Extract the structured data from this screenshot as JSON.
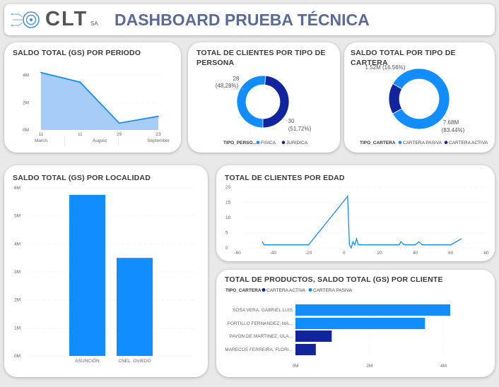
{
  "header": {
    "logo_text": "CLT",
    "logo_suffix": "SA",
    "title": "DASHBOARD PRUEBA TÉCNICA",
    "accent": "#5a6b9a"
  },
  "colors": {
    "primary": "#118dff",
    "dark": "#12239e",
    "area_fill": "#a7cdf6"
  },
  "chart_data": [
    {
      "id": "saldo_periodo",
      "type": "area",
      "title": "SALDO TOTAL (GS) POR PERIODO",
      "x_ticks": [
        "11",
        "11",
        "29",
        "23"
      ],
      "x_groups": [
        "March",
        "August",
        "September"
      ],
      "y_ticks": [
        "4M",
        "2M",
        "0M"
      ],
      "values": [
        4.2,
        3.5,
        0.5,
        1.0
      ],
      "ylim": [
        0,
        4.5
      ]
    },
    {
      "id": "clientes_persona",
      "type": "pie",
      "title": "TOTAL DE CLIENTES POR TIPO DE PERSONA",
      "legend_title": "TIPO_PERSO...",
      "slices": [
        {
          "name": "FISICA",
          "value": 30,
          "label": "30",
          "pct": "(51.72%)",
          "color": "#118dff"
        },
        {
          "name": "JURIDICA",
          "value": 28,
          "label": "28",
          "pct": "(48.28%)",
          "color": "#12239e"
        }
      ]
    },
    {
      "id": "saldo_cartera",
      "type": "pie",
      "title": "SALDO TOTAL POR TIPO DE CARTERA",
      "legend_title": "TIPO_CARTERA",
      "slices": [
        {
          "name": "CARTERA PASIVA",
          "value": 7.68,
          "label": "7.68M",
          "pct": "(83.44%)",
          "color": "#118dff"
        },
        {
          "name": "CARTERA ACTIVA",
          "value": 1.52,
          "label": "1.52M (16.56%)",
          "pct": "",
          "color": "#12239e"
        }
      ]
    },
    {
      "id": "saldo_localidad",
      "type": "bar",
      "title": "SALDO TOTAL (GS) POR LOCALIDAD",
      "categories": [
        "ASUNCIÓN",
        "CNEL. OVIEDO"
      ],
      "values": [
        5.75,
        3.5
      ],
      "y_ticks": [
        "6M",
        "5M",
        "4M",
        "3M",
        "2M",
        "1M",
        "0M"
      ],
      "ylim": [
        0,
        6
      ]
    },
    {
      "id": "clientes_edad",
      "type": "line",
      "title": "TOTAL DE CLIENTES POR EDAD",
      "x_ticks": [
        "-60",
        "-40",
        "-20",
        "0",
        "20",
        "40",
        "60",
        "80"
      ],
      "y_ticks": [
        "20",
        "15",
        "10",
        "5",
        "0"
      ],
      "xlim": [
        -60,
        80
      ],
      "ylim": [
        0,
        20
      ],
      "x": [
        -46,
        -45,
        -42,
        -38,
        -30,
        -22,
        -20,
        2,
        3,
        4,
        5,
        6,
        7,
        8,
        10,
        13,
        14,
        16,
        18,
        20,
        24,
        28,
        31,
        32,
        34,
        36,
        40,
        42,
        44,
        48,
        52,
        56,
        60,
        66
      ],
      "y": [
        2,
        1,
        1,
        1,
        1,
        1,
        1,
        17,
        1,
        0,
        2,
        1,
        3,
        1,
        1,
        1,
        1,
        1,
        1,
        1,
        1,
        1,
        1,
        2,
        1,
        1,
        1,
        2,
        1,
        1,
        1,
        1,
        1,
        3
      ]
    },
    {
      "id": "productos_cliente",
      "type": "bar",
      "orientation": "horizontal",
      "title": "TOTAL DE PRODUCTOS, SALDO TOTAL (GS) POR CLIENTE",
      "legend_title": "TIPO_CARTERA",
      "legend": [
        {
          "name": "CARTERA ACTIVA",
          "color": "#12239e"
        },
        {
          "name": "CARTERA PASIVA",
          "color": "#118dff"
        }
      ],
      "categories": [
        "SOSA VERA, GABRIEL LUIS",
        "PORTILLO FERNANDEZ, MA...",
        "PAVON DE MARTINEZ, GLA...",
        "MARECOS FERREIRA, FLORI..."
      ],
      "values": [
        4.18,
        3.5,
        0.98,
        0.55
      ],
      "series_of_bar": [
        "CARTERA PASIVA",
        "CARTERA PASIVA",
        "CARTERA ACTIVA",
        "CARTERA ACTIVA"
      ],
      "x_ticks": [
        "0M",
        "2M",
        "4M"
      ],
      "xlim": [
        0,
        4.2
      ]
    }
  ]
}
